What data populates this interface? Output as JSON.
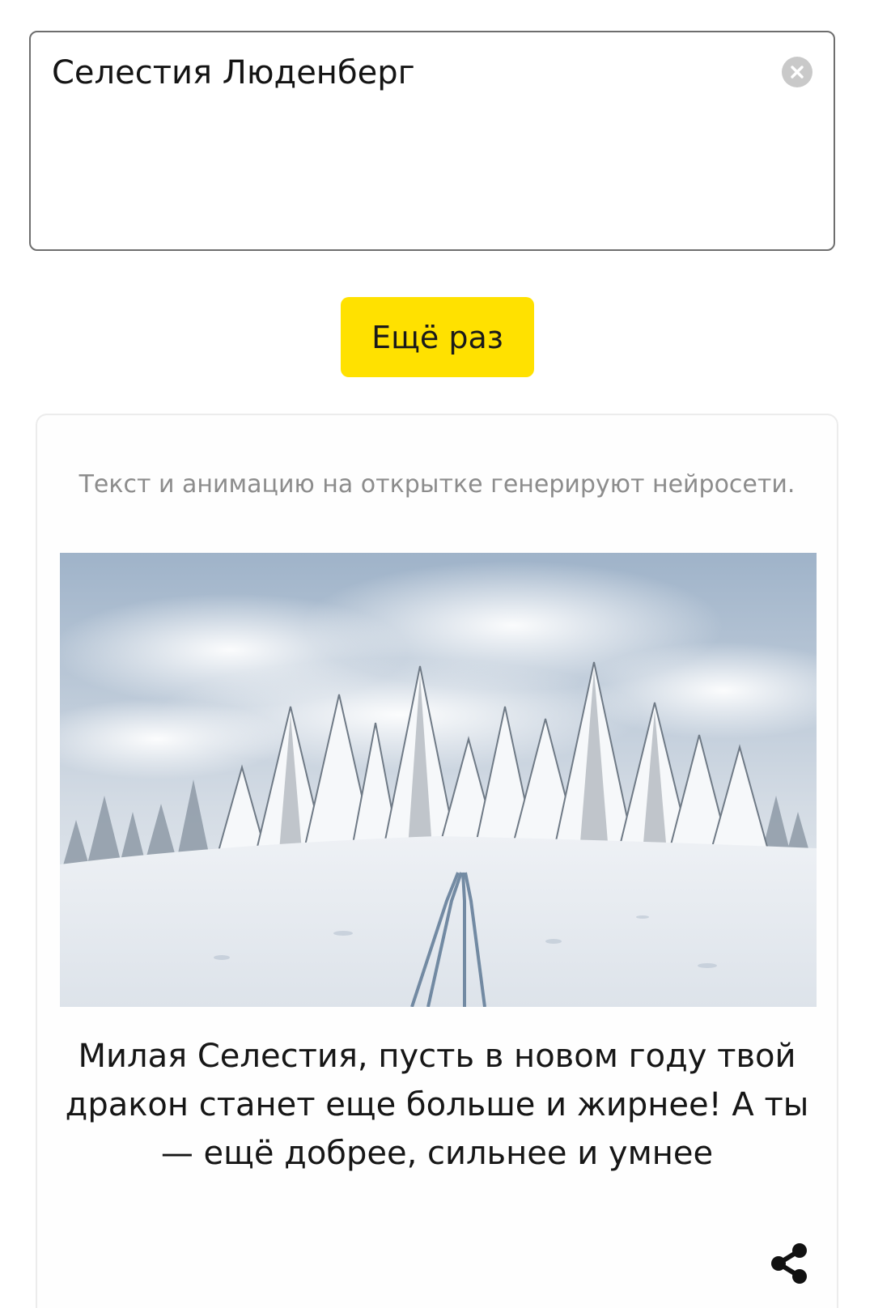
{
  "name_input": {
    "value": "Селестия Люденберг",
    "clear_icon": "close-circle-icon"
  },
  "again_button": {
    "label": "Ещё раз",
    "color": "#ffe100"
  },
  "card": {
    "disclaimer": "Текст и анимацию на открытке генерируют нейросети.",
    "image": "snowy-forest-ski-track",
    "greeting": "Милая Селестия, пусть в новом году твой дракон станет еще больше и жирнее! А ты — ещё добрее, сильнее и умнее",
    "share_icon": "share-icon"
  }
}
